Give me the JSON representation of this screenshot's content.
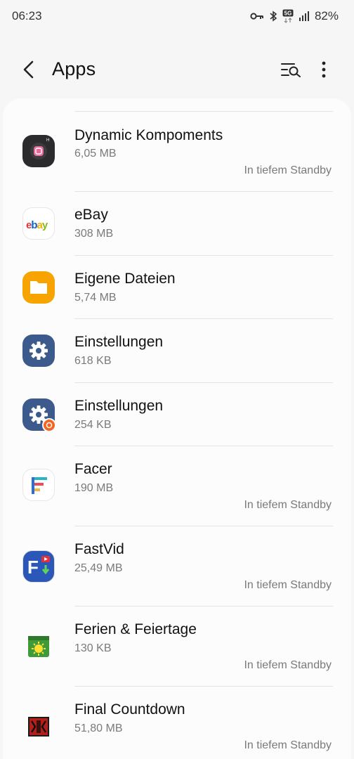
{
  "status_bar": {
    "time": "06:23",
    "network": "5G",
    "battery": "82%",
    "icons": [
      "vpn-key-icon",
      "bluetooth-icon",
      "5g-icon",
      "signal-icon"
    ]
  },
  "header": {
    "title": "Apps",
    "back_icon": "back-arrow-icon",
    "search_icon": "search-filter-icon",
    "more_icon": "more-vert-icon"
  },
  "apps": [
    {
      "name": "Dynamic Kompoments",
      "size": "6,05 MB",
      "status": "In tiefem Standby",
      "icon": "dynamic-kompoments-icon"
    },
    {
      "name": "eBay",
      "size": "308 MB",
      "status": "",
      "icon": "ebay-icon"
    },
    {
      "name": "Eigene Dateien",
      "size": "5,74 MB",
      "status": "",
      "icon": "folder-icon"
    },
    {
      "name": "Einstellungen",
      "size": "618 KB",
      "status": "",
      "icon": "settings-gear-icon"
    },
    {
      "name": "Einstellungen",
      "size": "254 KB",
      "status": "",
      "icon": "settings-gear-badge-icon"
    },
    {
      "name": "Facer",
      "size": "190 MB",
      "status": "In tiefem Standby",
      "icon": "facer-icon"
    },
    {
      "name": "FastVid",
      "size": "25,49 MB",
      "status": "In tiefem Standby",
      "icon": "fastvid-icon"
    },
    {
      "name": "Ferien & Feiertage",
      "size": "130 KB",
      "status": "In tiefem Standby",
      "icon": "calendar-sun-icon"
    },
    {
      "name": "Final Countdown",
      "size": "51,80 MB",
      "status": "In tiefem Standby",
      "icon": "final-countdown-icon"
    }
  ]
}
